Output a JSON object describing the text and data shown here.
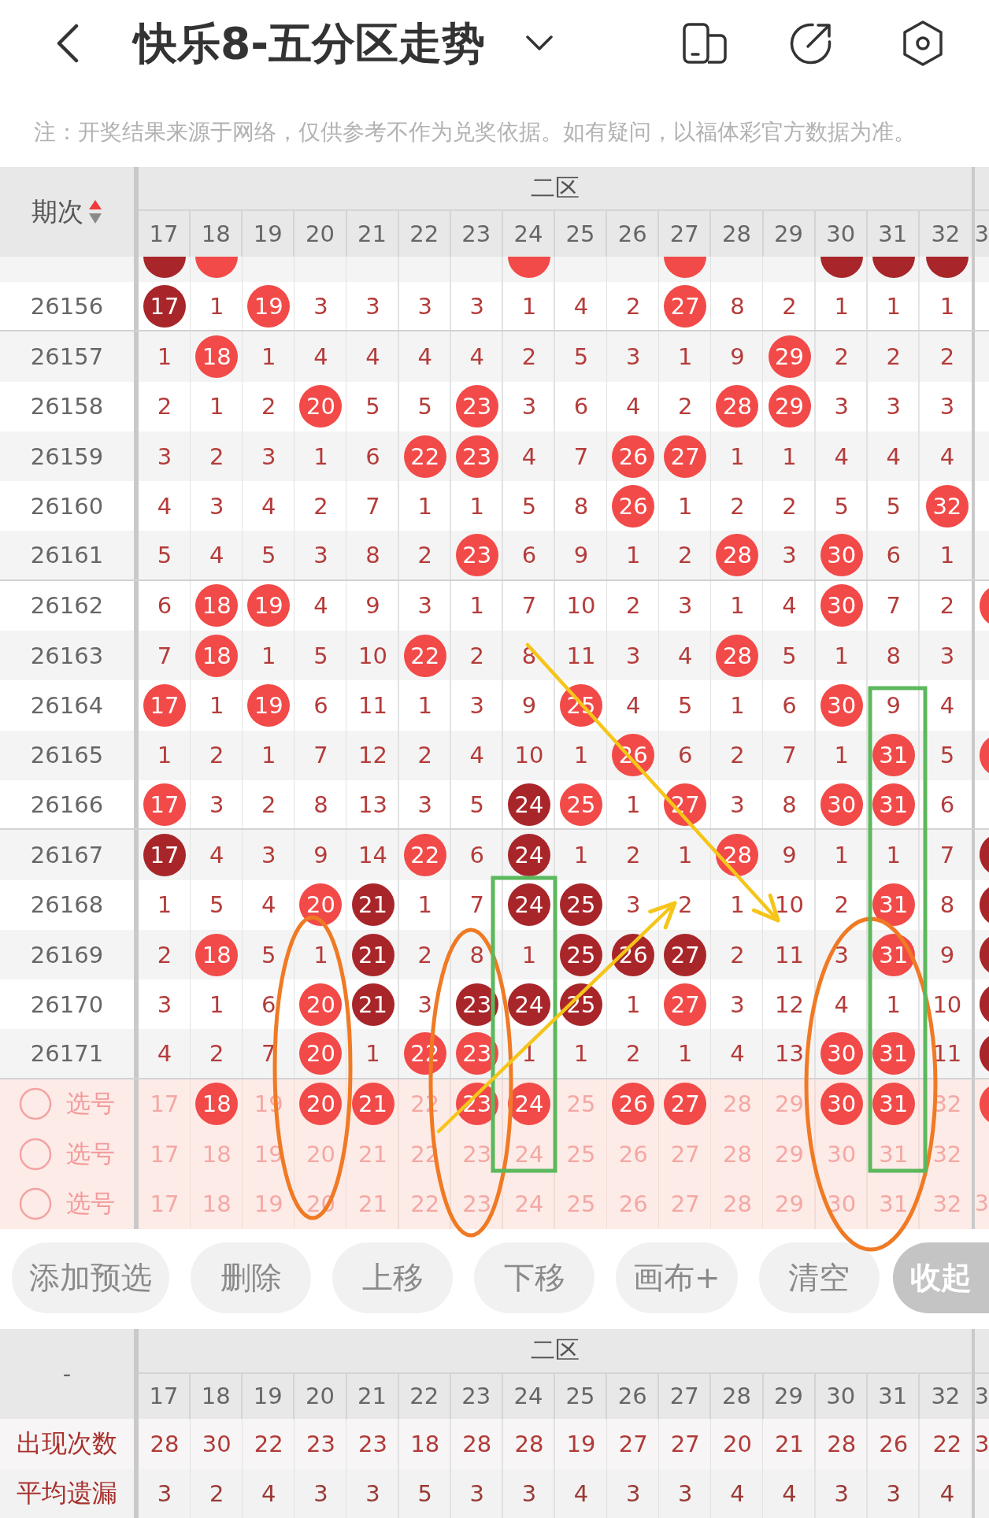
{
  "header": {
    "title": "快乐8-五分区走势"
  },
  "notice": "注：开奖结果来源于网络，仅供参考不作为兑奖依据。如有疑问，以福体彩官方数据为准。",
  "trend_table": {
    "issue_heading": "期次",
    "ascending": true,
    "zone_heading": "二区",
    "columns": [
      "17",
      "18",
      "19",
      "20",
      "21",
      "22",
      "23",
      "24",
      "25",
      "26",
      "27",
      "28",
      "29",
      "30",
      "31",
      "32"
    ],
    "cut_column": "3",
    "rows": [
      {
        "cells": [
          {
            "kind": "dark"
          },
          {
            "kind": "hit"
          },
          {
            "kind": "plain"
          },
          {
            "kind": "plain"
          },
          {
            "kind": "plain"
          },
          {
            "kind": "plain"
          },
          {
            "kind": "plain"
          },
          {
            "kind": "hit"
          },
          {
            "kind": "plain"
          },
          {
            "kind": "plain"
          },
          {
            "kind": "hit"
          },
          {
            "kind": "plain"
          },
          {
            "kind": "plain"
          },
          {
            "kind": "dark"
          },
          {
            "kind": "dark"
          },
          {
            "kind": "dark"
          }
        ]
      },
      {
        "issue": "26156",
        "cells": [
          {
            "text": "17",
            "kind": "dark"
          },
          {
            "text": "1",
            "kind": "plain"
          },
          {
            "text": "19",
            "kind": "hit"
          },
          {
            "text": "3",
            "kind": "plain"
          },
          {
            "text": "3",
            "kind": "plain"
          },
          {
            "text": "3",
            "kind": "plain"
          },
          {
            "text": "3",
            "kind": "plain"
          },
          {
            "text": "1",
            "kind": "plain"
          },
          {
            "text": "4",
            "kind": "plain"
          },
          {
            "text": "2",
            "kind": "plain"
          },
          {
            "text": "27",
            "kind": "hit"
          },
          {
            "text": "8",
            "kind": "plain"
          },
          {
            "text": "2",
            "kind": "plain"
          },
          {
            "text": "1",
            "kind": "plain"
          },
          {
            "text": "1",
            "kind": "plain"
          },
          {
            "text": "1",
            "kind": "plain"
          }
        ]
      },
      {
        "issue": "26157",
        "cells": [
          {
            "text": "1",
            "kind": "plain"
          },
          {
            "text": "18",
            "kind": "hit"
          },
          {
            "text": "1",
            "kind": "plain"
          },
          {
            "text": "4",
            "kind": "plain"
          },
          {
            "text": "4",
            "kind": "plain"
          },
          {
            "text": "4",
            "kind": "plain"
          },
          {
            "text": "4",
            "kind": "plain"
          },
          {
            "text": "2",
            "kind": "plain"
          },
          {
            "text": "5",
            "kind": "plain"
          },
          {
            "text": "3",
            "kind": "plain"
          },
          {
            "text": "1",
            "kind": "plain"
          },
          {
            "text": "9",
            "kind": "plain"
          },
          {
            "text": "29",
            "kind": "hit"
          },
          {
            "text": "2",
            "kind": "plain"
          },
          {
            "text": "2",
            "kind": "plain"
          },
          {
            "text": "2",
            "kind": "plain"
          }
        ]
      },
      {
        "issue": "26158",
        "cells": [
          {
            "text": "2",
            "kind": "plain"
          },
          {
            "text": "1",
            "kind": "plain"
          },
          {
            "text": "2",
            "kind": "plain"
          },
          {
            "text": "20",
            "kind": "hit"
          },
          {
            "text": "5",
            "kind": "plain"
          },
          {
            "text": "5",
            "kind": "plain"
          },
          {
            "text": "23",
            "kind": "hit"
          },
          {
            "text": "3",
            "kind": "plain"
          },
          {
            "text": "6",
            "kind": "plain"
          },
          {
            "text": "4",
            "kind": "plain"
          },
          {
            "text": "2",
            "kind": "plain"
          },
          {
            "text": "28",
            "kind": "hit"
          },
          {
            "text": "29",
            "kind": "hit"
          },
          {
            "text": "3",
            "kind": "plain"
          },
          {
            "text": "3",
            "kind": "plain"
          },
          {
            "text": "3",
            "kind": "plain"
          }
        ]
      },
      {
        "issue": "26159",
        "cells": [
          {
            "text": "3",
            "kind": "plain"
          },
          {
            "text": "2",
            "kind": "plain"
          },
          {
            "text": "3",
            "kind": "plain"
          },
          {
            "text": "1",
            "kind": "plain"
          },
          {
            "text": "6",
            "kind": "plain"
          },
          {
            "text": "22",
            "kind": "hit"
          },
          {
            "text": "23",
            "kind": "hit"
          },
          {
            "text": "4",
            "kind": "plain"
          },
          {
            "text": "7",
            "kind": "plain"
          },
          {
            "text": "26",
            "kind": "hit"
          },
          {
            "text": "27",
            "kind": "hit"
          },
          {
            "text": "1",
            "kind": "plain"
          },
          {
            "text": "1",
            "kind": "plain"
          },
          {
            "text": "4",
            "kind": "plain"
          },
          {
            "text": "4",
            "kind": "plain"
          },
          {
            "text": "4",
            "kind": "plain"
          }
        ]
      },
      {
        "issue": "26160",
        "cells": [
          {
            "text": "4",
            "kind": "plain"
          },
          {
            "text": "3",
            "kind": "plain"
          },
          {
            "text": "4",
            "kind": "plain"
          },
          {
            "text": "2",
            "kind": "plain"
          },
          {
            "text": "7",
            "kind": "plain"
          },
          {
            "text": "1",
            "kind": "plain"
          },
          {
            "text": "1",
            "kind": "plain"
          },
          {
            "text": "5",
            "kind": "plain"
          },
          {
            "text": "8",
            "kind": "plain"
          },
          {
            "text": "26",
            "kind": "hit"
          },
          {
            "text": "1",
            "kind": "plain"
          },
          {
            "text": "2",
            "kind": "plain"
          },
          {
            "text": "2",
            "kind": "plain"
          },
          {
            "text": "5",
            "kind": "plain"
          },
          {
            "text": "5",
            "kind": "plain"
          },
          {
            "text": "32",
            "kind": "hit"
          }
        ]
      },
      {
        "issue": "26161",
        "cells": [
          {
            "text": "5",
            "kind": "plain"
          },
          {
            "text": "4",
            "kind": "plain"
          },
          {
            "text": "5",
            "kind": "plain"
          },
          {
            "text": "3",
            "kind": "plain"
          },
          {
            "text": "8",
            "kind": "plain"
          },
          {
            "text": "2",
            "kind": "plain"
          },
          {
            "text": "23",
            "kind": "hit"
          },
          {
            "text": "6",
            "kind": "plain"
          },
          {
            "text": "9",
            "kind": "plain"
          },
          {
            "text": "1",
            "kind": "plain"
          },
          {
            "text": "2",
            "kind": "plain"
          },
          {
            "text": "28",
            "kind": "hit"
          },
          {
            "text": "3",
            "kind": "plain"
          },
          {
            "text": "30",
            "kind": "hit"
          },
          {
            "text": "6",
            "kind": "plain"
          },
          {
            "text": "1",
            "kind": "plain"
          }
        ]
      },
      {
        "issue": "26162",
        "cells": [
          {
            "text": "6",
            "kind": "plain"
          },
          {
            "text": "18",
            "kind": "hit"
          },
          {
            "text": "19",
            "kind": "hit"
          },
          {
            "text": "4",
            "kind": "plain"
          },
          {
            "text": "9",
            "kind": "plain"
          },
          {
            "text": "3",
            "kind": "plain"
          },
          {
            "text": "1",
            "kind": "plain"
          },
          {
            "text": "7",
            "kind": "plain"
          },
          {
            "text": "10",
            "kind": "plain"
          },
          {
            "text": "2",
            "kind": "plain"
          },
          {
            "text": "3",
            "kind": "plain"
          },
          {
            "text": "1",
            "kind": "plain"
          },
          {
            "text": "4",
            "kind": "plain"
          },
          {
            "text": "30",
            "kind": "hit"
          },
          {
            "text": "7",
            "kind": "plain"
          },
          {
            "text": "2",
            "kind": "plain"
          }
        ],
        "cut_cell": {
          "kind": "hit"
        }
      },
      {
        "issue": "26163",
        "cells": [
          {
            "text": "7",
            "kind": "plain"
          },
          {
            "text": "18",
            "kind": "hit"
          },
          {
            "text": "1",
            "kind": "plain"
          },
          {
            "text": "5",
            "kind": "plain"
          },
          {
            "text": "10",
            "kind": "plain"
          },
          {
            "text": "22",
            "kind": "hit"
          },
          {
            "text": "2",
            "kind": "plain"
          },
          {
            "text": "8",
            "kind": "plain"
          },
          {
            "text": "11",
            "kind": "plain"
          },
          {
            "text": "3",
            "kind": "plain"
          },
          {
            "text": "4",
            "kind": "plain"
          },
          {
            "text": "28",
            "kind": "hit"
          },
          {
            "text": "5",
            "kind": "plain"
          },
          {
            "text": "1",
            "kind": "plain"
          },
          {
            "text": "8",
            "kind": "plain"
          },
          {
            "text": "3",
            "kind": "plain"
          }
        ]
      },
      {
        "issue": "26164",
        "cells": [
          {
            "text": "17",
            "kind": "hit"
          },
          {
            "text": "1",
            "kind": "plain"
          },
          {
            "text": "19",
            "kind": "hit"
          },
          {
            "text": "6",
            "kind": "plain"
          },
          {
            "text": "11",
            "kind": "plain"
          },
          {
            "text": "1",
            "kind": "plain"
          },
          {
            "text": "3",
            "kind": "plain"
          },
          {
            "text": "9",
            "kind": "plain"
          },
          {
            "text": "25",
            "kind": "hit"
          },
          {
            "text": "4",
            "kind": "plain"
          },
          {
            "text": "5",
            "kind": "plain"
          },
          {
            "text": "1",
            "kind": "plain"
          },
          {
            "text": "6",
            "kind": "plain"
          },
          {
            "text": "30",
            "kind": "hit"
          },
          {
            "text": "9",
            "kind": "plain"
          },
          {
            "text": "4",
            "kind": "plain"
          }
        ]
      },
      {
        "issue": "26165",
        "cells": [
          {
            "text": "1",
            "kind": "plain"
          },
          {
            "text": "2",
            "kind": "plain"
          },
          {
            "text": "1",
            "kind": "plain"
          },
          {
            "text": "7",
            "kind": "plain"
          },
          {
            "text": "12",
            "kind": "plain"
          },
          {
            "text": "2",
            "kind": "plain"
          },
          {
            "text": "4",
            "kind": "plain"
          },
          {
            "text": "10",
            "kind": "plain"
          },
          {
            "text": "1",
            "kind": "plain"
          },
          {
            "text": "26",
            "kind": "hit"
          },
          {
            "text": "6",
            "kind": "plain"
          },
          {
            "text": "2",
            "kind": "plain"
          },
          {
            "text": "7",
            "kind": "plain"
          },
          {
            "text": "1",
            "kind": "plain"
          },
          {
            "text": "31",
            "kind": "hit"
          },
          {
            "text": "5",
            "kind": "plain"
          }
        ],
        "cut_cell": {
          "kind": "hit"
        }
      },
      {
        "issue": "26166",
        "cells": [
          {
            "text": "17",
            "kind": "hit"
          },
          {
            "text": "3",
            "kind": "plain"
          },
          {
            "text": "2",
            "kind": "plain"
          },
          {
            "text": "8",
            "kind": "plain"
          },
          {
            "text": "13",
            "kind": "plain"
          },
          {
            "text": "3",
            "kind": "plain"
          },
          {
            "text": "5",
            "kind": "plain"
          },
          {
            "text": "24",
            "kind": "dark"
          },
          {
            "text": "25",
            "kind": "hit"
          },
          {
            "text": "1",
            "kind": "plain"
          },
          {
            "text": "27",
            "kind": "hit"
          },
          {
            "text": "3",
            "kind": "plain"
          },
          {
            "text": "8",
            "kind": "plain"
          },
          {
            "text": "30",
            "kind": "hit"
          },
          {
            "text": "31",
            "kind": "hit"
          },
          {
            "text": "6",
            "kind": "plain"
          }
        ]
      },
      {
        "issue": "26167",
        "cells": [
          {
            "text": "17",
            "kind": "dark"
          },
          {
            "text": "4",
            "kind": "plain"
          },
          {
            "text": "3",
            "kind": "plain"
          },
          {
            "text": "9",
            "kind": "plain"
          },
          {
            "text": "14",
            "kind": "plain"
          },
          {
            "text": "22",
            "kind": "hit"
          },
          {
            "text": "6",
            "kind": "plain"
          },
          {
            "text": "24",
            "kind": "dark"
          },
          {
            "text": "1",
            "kind": "plain"
          },
          {
            "text": "2",
            "kind": "plain"
          },
          {
            "text": "1",
            "kind": "plain"
          },
          {
            "text": "28",
            "kind": "hit"
          },
          {
            "text": "9",
            "kind": "plain"
          },
          {
            "text": "1",
            "kind": "plain"
          },
          {
            "text": "1",
            "kind": "plain"
          },
          {
            "text": "7",
            "kind": "plain"
          }
        ],
        "cut_cell": {
          "kind": "dark"
        }
      },
      {
        "issue": "26168",
        "cells": [
          {
            "text": "1",
            "kind": "plain"
          },
          {
            "text": "5",
            "kind": "plain"
          },
          {
            "text": "4",
            "kind": "plain"
          },
          {
            "text": "20",
            "kind": "hit"
          },
          {
            "text": "21",
            "kind": "dark"
          },
          {
            "text": "1",
            "kind": "plain"
          },
          {
            "text": "7",
            "kind": "plain"
          },
          {
            "text": "24",
            "kind": "dark"
          },
          {
            "text": "25",
            "kind": "dark"
          },
          {
            "text": "3",
            "kind": "plain"
          },
          {
            "text": "2",
            "kind": "plain"
          },
          {
            "text": "1",
            "kind": "plain"
          },
          {
            "text": "10",
            "kind": "plain"
          },
          {
            "text": "2",
            "kind": "plain"
          },
          {
            "text": "31",
            "kind": "hit"
          },
          {
            "text": "8",
            "kind": "plain"
          }
        ],
        "cut_cell": {
          "kind": "dark"
        }
      },
      {
        "issue": "26169",
        "cells": [
          {
            "text": "2",
            "kind": "plain"
          },
          {
            "text": "18",
            "kind": "hit"
          },
          {
            "text": "5",
            "kind": "plain"
          },
          {
            "text": "1",
            "kind": "plain"
          },
          {
            "text": "21",
            "kind": "dark"
          },
          {
            "text": "2",
            "kind": "plain"
          },
          {
            "text": "8",
            "kind": "plain"
          },
          {
            "text": "1",
            "kind": "plain"
          },
          {
            "text": "25",
            "kind": "dark"
          },
          {
            "text": "26",
            "kind": "dark"
          },
          {
            "text": "27",
            "kind": "dark"
          },
          {
            "text": "2",
            "kind": "plain"
          },
          {
            "text": "11",
            "kind": "plain"
          },
          {
            "text": "3",
            "kind": "plain"
          },
          {
            "text": "31",
            "kind": "hit"
          },
          {
            "text": "9",
            "kind": "plain"
          }
        ],
        "cut_cell": {
          "kind": "dark"
        }
      },
      {
        "issue": "26170",
        "cells": [
          {
            "text": "3",
            "kind": "plain"
          },
          {
            "text": "1",
            "kind": "plain"
          },
          {
            "text": "6",
            "kind": "plain"
          },
          {
            "text": "20",
            "kind": "hit"
          },
          {
            "text": "21",
            "kind": "dark"
          },
          {
            "text": "3",
            "kind": "plain"
          },
          {
            "text": "23",
            "kind": "dark"
          },
          {
            "text": "24",
            "kind": "dark"
          },
          {
            "text": "25",
            "kind": "dark"
          },
          {
            "text": "1",
            "kind": "plain"
          },
          {
            "text": "27",
            "kind": "hit"
          },
          {
            "text": "3",
            "kind": "plain"
          },
          {
            "text": "12",
            "kind": "plain"
          },
          {
            "text": "4",
            "kind": "plain"
          },
          {
            "text": "1",
            "kind": "plain"
          },
          {
            "text": "10",
            "kind": "plain"
          }
        ],
        "cut_cell": {
          "kind": "dark"
        }
      },
      {
        "issue": "26171",
        "cells": [
          {
            "text": "4",
            "kind": "plain"
          },
          {
            "text": "2",
            "kind": "plain"
          },
          {
            "text": "7",
            "kind": "plain"
          },
          {
            "text": "20",
            "kind": "hit"
          },
          {
            "text": "1",
            "kind": "plain"
          },
          {
            "text": "22",
            "kind": "hit"
          },
          {
            "text": "23",
            "kind": "hit"
          },
          {
            "text": "1",
            "kind": "plain"
          },
          {
            "text": "1",
            "kind": "plain"
          },
          {
            "text": "2",
            "kind": "plain"
          },
          {
            "text": "1",
            "kind": "plain"
          },
          {
            "text": "4",
            "kind": "plain"
          },
          {
            "text": "13",
            "kind": "plain"
          },
          {
            "text": "30",
            "kind": "hit"
          },
          {
            "text": "31",
            "kind": "hit"
          },
          {
            "text": "11",
            "kind": "plain"
          }
        ],
        "cut_cell": {
          "kind": "dark"
        }
      }
    ],
    "pick_rows": [
      {
        "label": "选号",
        "checked": false,
        "cells": [
          {
            "text": "17",
            "selected": false
          },
          {
            "text": "18",
            "selected": true
          },
          {
            "text": "19",
            "selected": false
          },
          {
            "text": "20",
            "selected": true
          },
          {
            "text": "21",
            "selected": true
          },
          {
            "text": "22",
            "selected": false
          },
          {
            "text": "23",
            "selected": true
          },
          {
            "text": "24",
            "selected": true
          },
          {
            "text": "25",
            "selected": false
          },
          {
            "text": "26",
            "selected": true
          },
          {
            "text": "27",
            "selected": true
          },
          {
            "text": "28",
            "selected": false
          },
          {
            "text": "29",
            "selected": false
          },
          {
            "text": "30",
            "selected": true
          },
          {
            "text": "31",
            "selected": true
          },
          {
            "text": "32",
            "selected": false
          }
        ],
        "cut_cell": {
          "selected": true
        }
      },
      {
        "label": "选号",
        "checked": false,
        "cells": [
          {
            "text": "17",
            "selected": false
          },
          {
            "text": "18",
            "selected": false
          },
          {
            "text": "19",
            "selected": false
          },
          {
            "text": "20",
            "selected": false
          },
          {
            "text": "21",
            "selected": false
          },
          {
            "text": "22",
            "selected": false
          },
          {
            "text": "23",
            "selected": false
          },
          {
            "text": "24",
            "selected": false
          },
          {
            "text": "25",
            "selected": false
          },
          {
            "text": "26",
            "selected": false
          },
          {
            "text": "27",
            "selected": false
          },
          {
            "text": "28",
            "selected": false
          },
          {
            "text": "29",
            "selected": false
          },
          {
            "text": "30",
            "selected": false
          },
          {
            "text": "31",
            "selected": false
          },
          {
            "text": "32",
            "selected": false
          }
        ]
      },
      {
        "label": "选号",
        "checked": false,
        "cells": [
          {
            "text": "17",
            "selected": false
          },
          {
            "text": "18",
            "selected": false
          },
          {
            "text": "19",
            "selected": false
          },
          {
            "text": "20",
            "selected": false
          },
          {
            "text": "21",
            "selected": false
          },
          {
            "text": "22",
            "selected": false
          },
          {
            "text": "23",
            "selected": false
          },
          {
            "text": "24",
            "selected": false
          },
          {
            "text": "25",
            "selected": false
          },
          {
            "text": "26",
            "selected": false
          },
          {
            "text": "27",
            "selected": false
          },
          {
            "text": "28",
            "selected": false
          },
          {
            "text": "29",
            "selected": false
          },
          {
            "text": "30",
            "selected": false
          },
          {
            "text": "31",
            "selected": false
          },
          {
            "text": "32",
            "selected": false
          }
        ],
        "cut_cell": {
          "text": "3",
          "selected": false
        }
      }
    ]
  },
  "actions": [
    {
      "label": "添加预选",
      "kind": "normal"
    },
    {
      "label": "删除",
      "kind": "normal"
    },
    {
      "label": "上移",
      "kind": "normal"
    },
    {
      "label": "下移",
      "kind": "normal"
    },
    {
      "label": "画布+",
      "kind": "normal"
    },
    {
      "label": "清空",
      "kind": "normal"
    },
    {
      "label": "收起",
      "kind": "primary"
    }
  ],
  "stats_table": {
    "corner": "-",
    "zone_heading": "二区",
    "columns": [
      "17",
      "18",
      "19",
      "20",
      "21",
      "22",
      "23",
      "24",
      "25",
      "26",
      "27",
      "28",
      "29",
      "30",
      "31",
      "32"
    ],
    "cut_column": "3",
    "rows": [
      {
        "label": "出现次数",
        "values": [
          "28",
          "30",
          "22",
          "23",
          "23",
          "18",
          "28",
          "28",
          "19",
          "27",
          "27",
          "20",
          "21",
          "28",
          "26",
          "22"
        ],
        "cut_value": "3"
      },
      {
        "label": "平均遗漏",
        "values": [
          "3",
          "2",
          "4",
          "3",
          "3",
          "5",
          "3",
          "3",
          "4",
          "3",
          "3",
          "4",
          "4",
          "3",
          "3",
          "4"
        ]
      }
    ]
  },
  "annotations": [
    {
      "kind": "ellipse",
      "color": "#f07a24"
    },
    {
      "kind": "ellipse",
      "color": "#f07a24"
    },
    {
      "kind": "ellipse",
      "color": "#f07a24"
    },
    {
      "kind": "rect",
      "color": "#5cb85c"
    },
    {
      "kind": "rect",
      "color": "#5cb85c"
    },
    {
      "kind": "arrow",
      "color": "#f5c51a"
    },
    {
      "kind": "arrow",
      "color": "#f5c51a"
    }
  ]
}
